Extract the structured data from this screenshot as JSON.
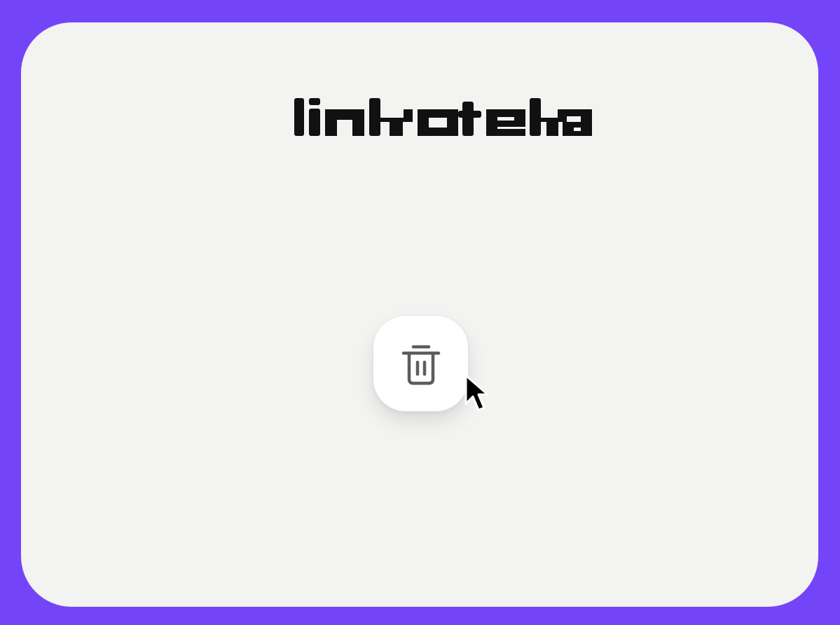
{
  "app": {
    "logo_text": "linkoteka"
  },
  "colors": {
    "background": "#7445f8",
    "card": "#f3f3f1",
    "button": "#ffffff",
    "icon": "#5d5d5d",
    "logo": "#111111"
  },
  "button": {
    "icon": "trash-icon"
  },
  "pointer": {
    "icon": "mouse-pointer-icon"
  }
}
